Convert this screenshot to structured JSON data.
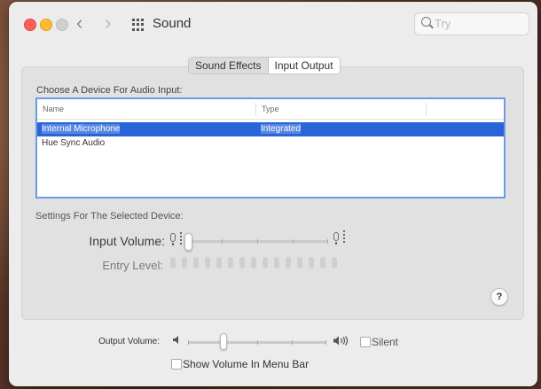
{
  "window": {
    "title": "Sound"
  },
  "search": {
    "placeholder": "Try"
  },
  "tabs": [
    {
      "label": "Sound Effects"
    },
    {
      "label": "Input Output"
    }
  ],
  "input_panel": {
    "choose_label": "Choose A Device For Audio Input:",
    "columns": [
      "Name",
      "Type"
    ],
    "devices": [
      {
        "name": "Internal Microphone",
        "type": "Integrated",
        "selected": true
      },
      {
        "name": "Hue Sync Audio",
        "type": "",
        "selected": false
      }
    ],
    "settings_label": "Settings For The Selected Device:",
    "input_volume_label": "Input Volume:",
    "input_volume_level": 0.03,
    "entry_level_label": "Entry Level:",
    "entry_level_active_bars": 0,
    "entry_level_total_bars": 15,
    "help_label": "?"
  },
  "output": {
    "volume_label": "Output Volume:",
    "volume_level": 0.25,
    "silent_label": "Silent",
    "silent_checked": false,
    "menubar_label": "Show Volume In Menu Bar",
    "menubar_checked": false
  },
  "colors": {
    "selection": "#2765d8",
    "focus_ring": "#6b9be8",
    "close": "#fe5f57",
    "minimize": "#febc2e"
  }
}
